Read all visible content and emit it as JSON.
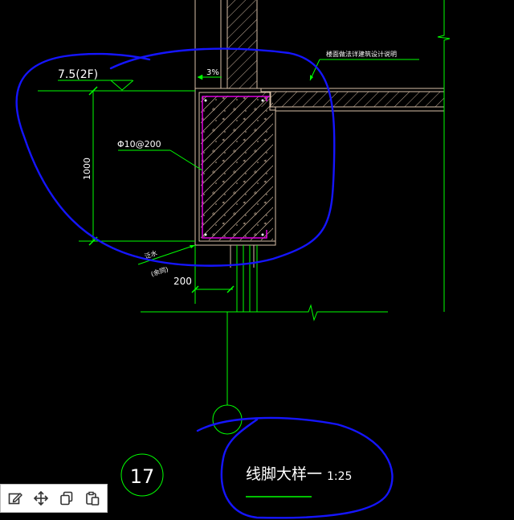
{
  "drawing": {
    "elevation_label": "7.5(2F)",
    "slope_label": "3%",
    "roof_note": "楼面做法详建筑设计说明",
    "rebar_label": "Φ10@200",
    "height_dim": "1000",
    "waterproof_note": "泛水",
    "waterproof_note_sub": "(余同)",
    "width_dim": "200",
    "detail_number": "17",
    "detail_title": "线脚大样一",
    "detail_scale": "1:25"
  },
  "colors": {
    "background": "#000000",
    "dimension_lines": "#00ff00",
    "wall_outline": "#d8bfa8",
    "rebar": "#e000e0",
    "annotation_markup": "#1515ff",
    "text": "#ffffff"
  },
  "toolbar": {
    "items": [
      {
        "icon": "edit-icon"
      },
      {
        "icon": "move-icon"
      },
      {
        "icon": "copy-icon"
      },
      {
        "icon": "paste-icon"
      }
    ]
  }
}
